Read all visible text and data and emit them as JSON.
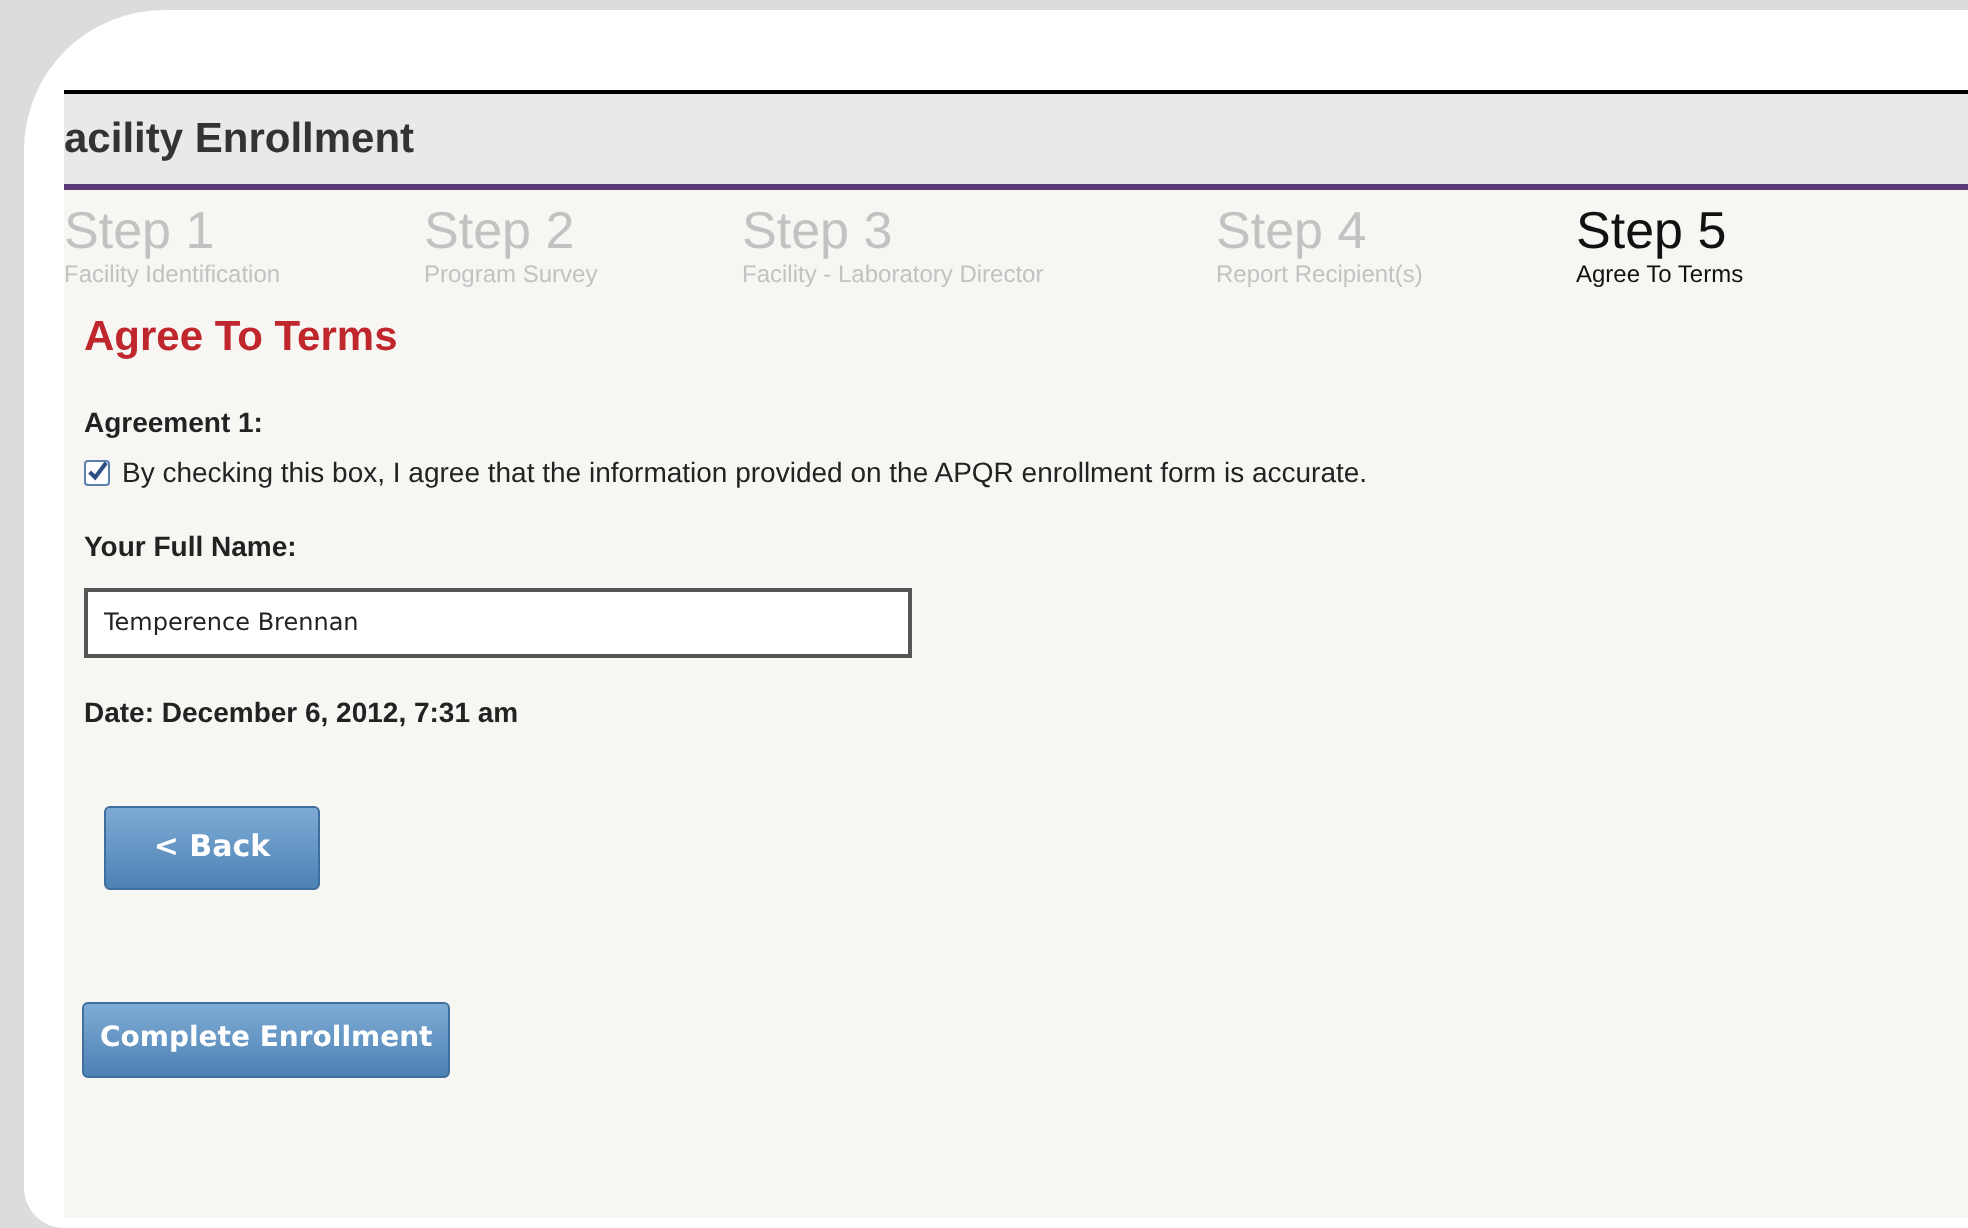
{
  "header": {
    "title": "acility Enrollment"
  },
  "steps": [
    {
      "number": "Step 1",
      "label": "Facility Identification",
      "selected": false
    },
    {
      "number": "Step 2",
      "label": "Program Survey",
      "selected": false
    },
    {
      "number": "Step 3",
      "label": "Facility - Laboratory Director",
      "selected": false
    },
    {
      "number": "Step 4",
      "label": "Report Recipient(s)",
      "selected": false
    },
    {
      "number": "Step 5",
      "label": "Agree To Terms",
      "selected": true
    }
  ],
  "section_title": "Agree To Terms",
  "agreement": {
    "heading": "Agreement 1:",
    "text": "By checking this box, I agree that the information provided on the APQR enrollment form is accurate.",
    "checked": true
  },
  "name_field": {
    "label": "Your Full Name:",
    "value": "Temperence Brennan"
  },
  "date": "Date: December 6, 2012, 7:31 am",
  "buttons": [
    {
      "kind": "back",
      "label": "< Back"
    },
    {
      "kind": "complete",
      "label": "Complete Enrollment"
    }
  ]
}
